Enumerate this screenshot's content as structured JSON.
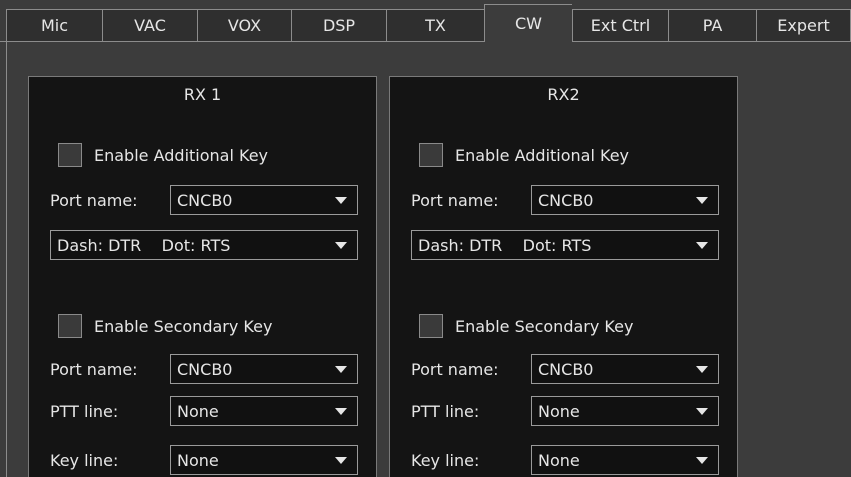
{
  "tabs": [
    {
      "label": "Mic"
    },
    {
      "label": "VAC"
    },
    {
      "label": "VOX"
    },
    {
      "label": "DSP"
    },
    {
      "label": "TX"
    },
    {
      "label": "CW",
      "active": true
    },
    {
      "label": "Ext Ctrl"
    },
    {
      "label": "PA"
    },
    {
      "label": "Expert"
    }
  ],
  "rx1": {
    "title": "RX 1",
    "additional_key": {
      "label": "Enable Additional Key",
      "checked": false,
      "port_label": "Port name:",
      "port_value": "CNCB0",
      "mode_value": "Dash: DTR    Dot: RTS"
    },
    "secondary_key": {
      "label": "Enable Secondary Key",
      "checked": false,
      "port_label": "Port name:",
      "port_value": "CNCB0",
      "ptt_label": "PTT line:",
      "ptt_value": "None",
      "key_label": "Key line:",
      "key_value": "None"
    }
  },
  "rx2": {
    "title": "RX2",
    "additional_key": {
      "label": "Enable Additional Key",
      "checked": false,
      "port_label": "Port name:",
      "port_value": "CNCB0",
      "mode_value": "Dash: DTR    Dot: RTS"
    },
    "secondary_key": {
      "label": "Enable Secondary Key",
      "checked": false,
      "port_label": "Port name:",
      "port_value": "CNCB0",
      "ptt_label": "PTT line:",
      "ptt_value": "None",
      "key_label": "Key line:",
      "key_value": "None"
    }
  }
}
